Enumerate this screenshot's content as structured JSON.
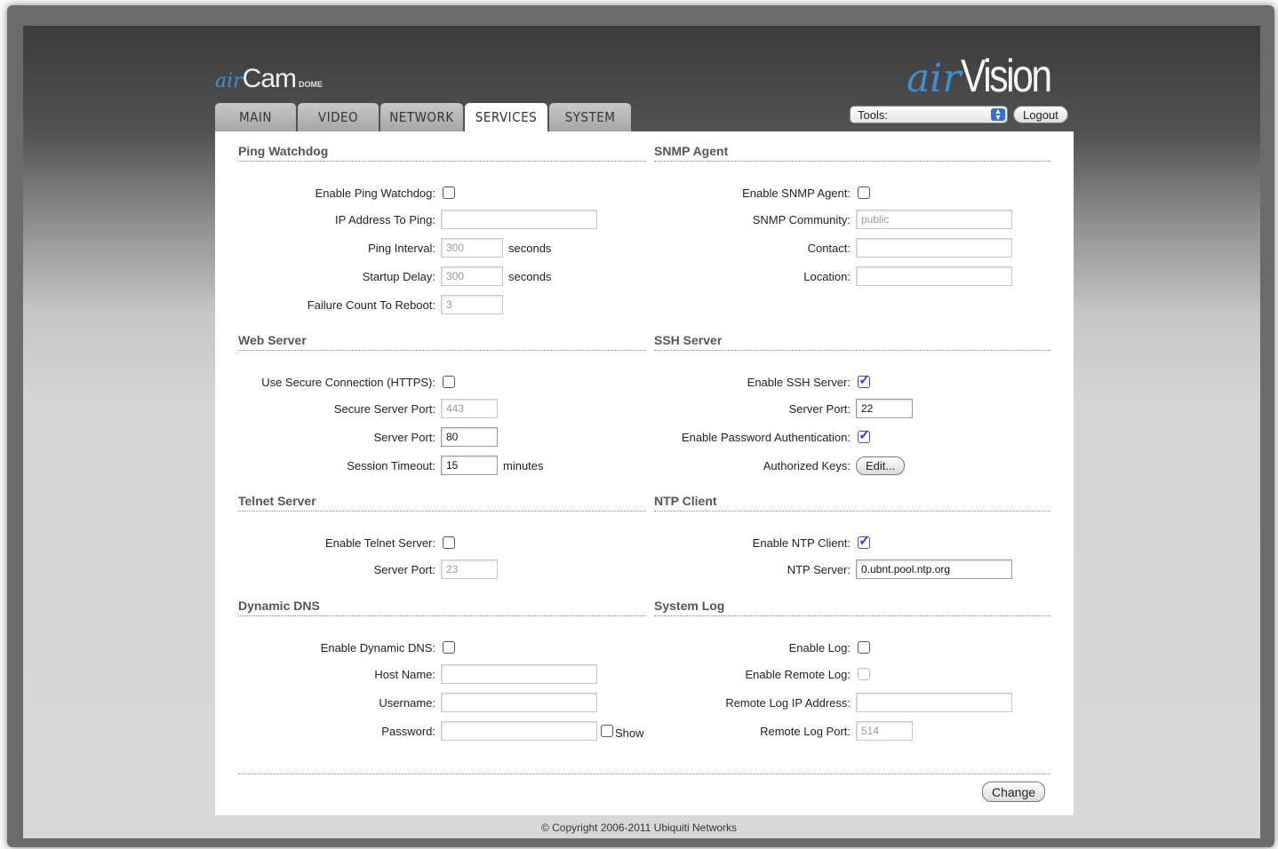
{
  "brand": {
    "left_air": "air",
    "left_cam": "Cam",
    "left_model": "DOME",
    "right_air": "air",
    "right_vision": "Vision"
  },
  "tabs": [
    {
      "label": "MAIN",
      "active": false
    },
    {
      "label": "VIDEO",
      "active": false
    },
    {
      "label": "NETWORK",
      "active": false
    },
    {
      "label": "SERVICES",
      "active": true
    },
    {
      "label": "SYSTEM",
      "active": false
    }
  ],
  "toolbar": {
    "tools_label": "Tools:",
    "logout_label": "Logout"
  },
  "ping": {
    "title": "Ping Watchdog",
    "enable_label": "Enable Ping Watchdog:",
    "ip_label": "IP Address To Ping:",
    "ip_value": "",
    "interval_label": "Ping Interval:",
    "interval_value": "300",
    "interval_unit": "seconds",
    "startup_label": "Startup Delay:",
    "startup_value": "300",
    "startup_unit": "seconds",
    "failure_label": "Failure Count To Reboot:",
    "failure_value": "3"
  },
  "snmp": {
    "title": "SNMP Agent",
    "enable_label": "Enable SNMP Agent:",
    "community_label": "SNMP Community:",
    "community_value": "public",
    "contact_label": "Contact:",
    "contact_value": "",
    "location_label": "Location:",
    "location_value": ""
  },
  "web": {
    "title": "Web Server",
    "https_label": "Use Secure Connection (HTTPS):",
    "secure_port_label": "Secure Server Port:",
    "secure_port_value": "443",
    "port_label": "Server Port:",
    "port_value": "80",
    "timeout_label": "Session Timeout:",
    "timeout_value": "15",
    "timeout_unit": "minutes"
  },
  "ssh": {
    "title": "SSH Server",
    "enable_label": "Enable SSH Server:",
    "port_label": "Server Port:",
    "port_value": "22",
    "pw_label": "Enable Password Authentication:",
    "keys_label": "Authorized Keys:",
    "keys_button": "Edit..."
  },
  "telnet": {
    "title": "Telnet Server",
    "enable_label": "Enable Telnet Server:",
    "port_label": "Server Port:",
    "port_value": "23"
  },
  "ntp": {
    "title": "NTP Client",
    "enable_label": "Enable NTP Client:",
    "server_label": "NTP Server:",
    "server_value": "0.ubnt.pool.ntp.org"
  },
  "ddns": {
    "title": "Dynamic DNS",
    "enable_label": "Enable Dynamic DNS:",
    "host_label": "Host Name:",
    "host_value": "",
    "user_label": "Username:",
    "user_value": "",
    "pass_label": "Password:",
    "pass_value": "",
    "show_label": "Show"
  },
  "syslog": {
    "title": "System Log",
    "enable_label": "Enable Log:",
    "remote_label": "Enable Remote Log:",
    "ip_label": "Remote Log IP Address:",
    "ip_value": "",
    "port_label": "Remote Log Port:",
    "port_value": "514"
  },
  "footer": {
    "change_button": "Change",
    "copyright": "© Copyright 2006-2011 Ubiquiti Networks"
  },
  "colors": {
    "accent_blue": "#3f8fd2",
    "check_blue": "#2553c8"
  }
}
